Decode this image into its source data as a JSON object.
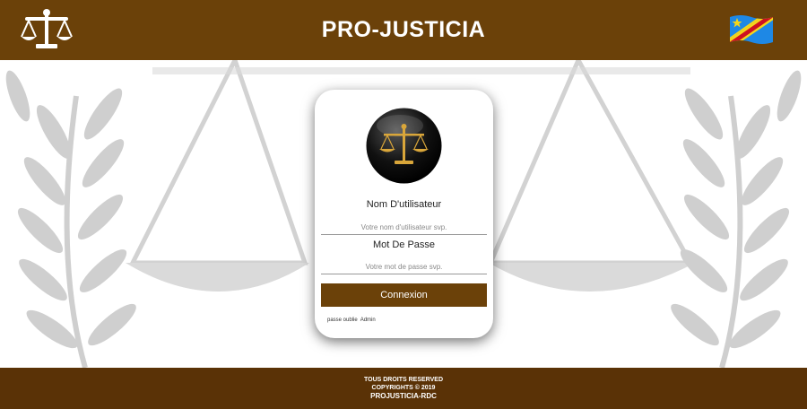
{
  "header": {
    "title": "PRO-JUSTICIA",
    "logo_icon": "scales-of-justice-icon",
    "flag_icon": "drc-flag-icon",
    "bg_color": "#6b4109"
  },
  "login": {
    "emblem_icon": "golden-scales-emblem",
    "username_label": "Nom D'utilisateur",
    "username_placeholder": "Votre nom d'utilisateur svp.",
    "username_value": "",
    "password_label": "Mot De Passe",
    "password_placeholder": "Votre mot de passe svp.",
    "password_value": "",
    "submit_label": "Connexion",
    "forgot_label": "passe oublie",
    "admin_label": "Admin",
    "accent_color": "#6b4109"
  },
  "footer": {
    "line1": "TOUS DROITS RESERVED",
    "line2": "COPYRIGHTS © 2019",
    "line3": "PROJUSTICIA-RDC",
    "bg_color": "#5a3206"
  }
}
